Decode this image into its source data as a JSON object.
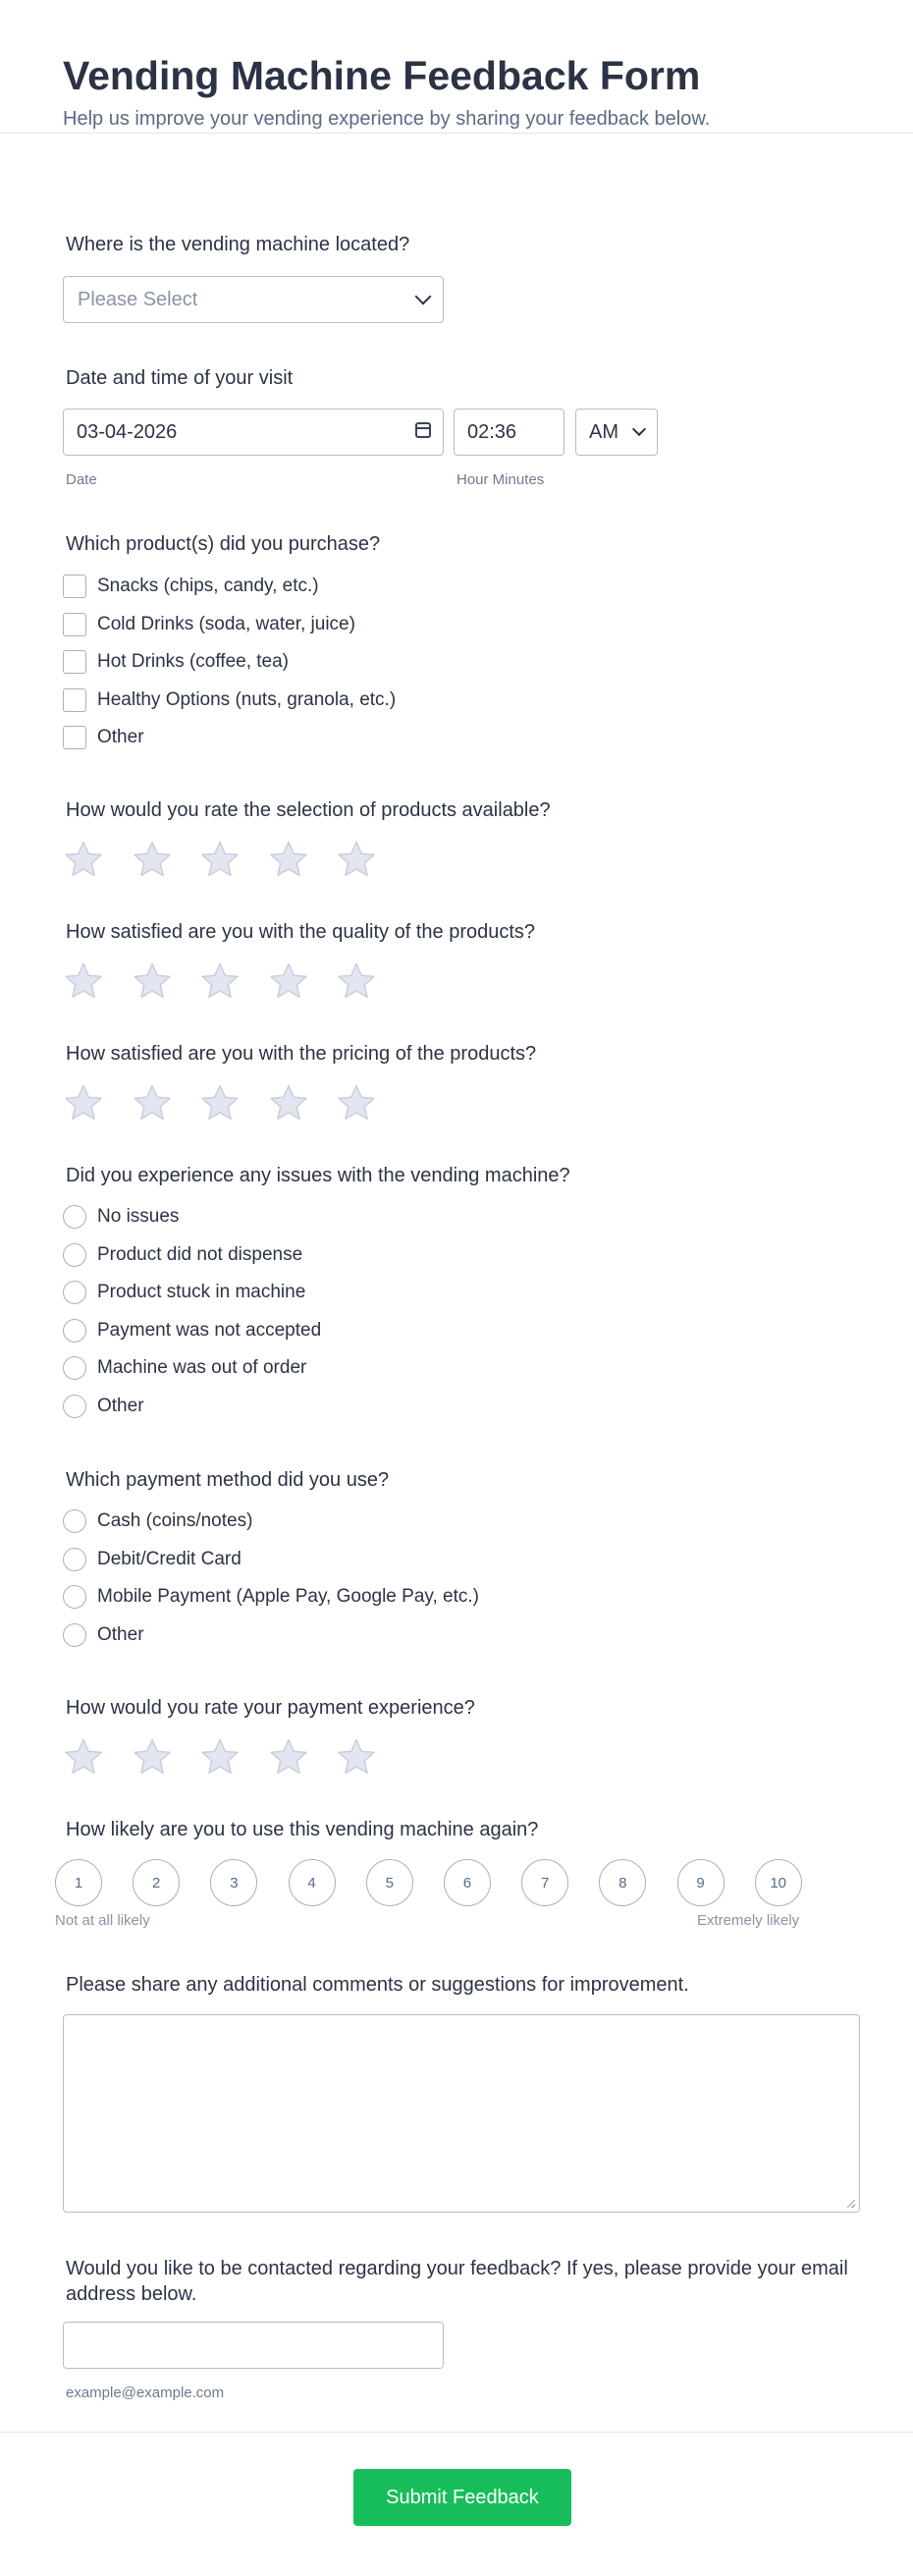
{
  "header": {
    "title": "Vending Machine Feedback Form",
    "subtitle": "Help us improve your vending experience by sharing your feedback below."
  },
  "location": {
    "label": "Where is the vending machine located?",
    "placeholder": "Please Select"
  },
  "visit": {
    "label": "Date and time of your visit",
    "date_value": "03-04-2026",
    "date_sublabel": "Date",
    "time_value": "02:36",
    "time_sublabel": "Hour Minutes",
    "ampm_value": "AM"
  },
  "products": {
    "label": "Which product(s) did you purchase?",
    "options": [
      "Snacks (chips, candy, etc.)",
      "Cold Drinks (soda, water, juice)",
      "Hot Drinks (coffee, tea)",
      "Healthy Options (nuts, granola, etc.)",
      "Other"
    ]
  },
  "rating_selection": {
    "label": "How would you rate the selection of products available?",
    "max": 5,
    "value": 0
  },
  "rating_quality": {
    "label": "How satisfied are you with the quality of the products?",
    "max": 5,
    "value": 0
  },
  "rating_pricing": {
    "label": "How satisfied are you with the pricing of the products?",
    "max": 5,
    "value": 0
  },
  "issues": {
    "label": "Did you experience any issues with the vending machine?",
    "options": [
      "No issues",
      "Product did not dispense",
      "Product stuck in machine",
      "Payment was not accepted",
      "Machine was out of order",
      "Other"
    ]
  },
  "payment": {
    "label": "Which payment method did you use?",
    "options": [
      "Cash (coins/notes)",
      "Debit/Credit Card",
      "Mobile Payment (Apple Pay, Google Pay, etc.)",
      "Other"
    ]
  },
  "rating_payment": {
    "label": "How would you rate your payment experience?",
    "max": 5,
    "value": 0
  },
  "likelihood": {
    "label": "How likely are you to use this vending machine again?",
    "values": [
      "1",
      "2",
      "3",
      "4",
      "5",
      "6",
      "7",
      "8",
      "9",
      "10"
    ],
    "min_label": "Not at all likely",
    "max_label": "Extremely likely"
  },
  "comments": {
    "label": "Please share any additional comments or suggestions for improvement."
  },
  "contact": {
    "label": "Would you like to be contacted regarding your feedback? If yes, please provide your email address below.",
    "sublabel": "example@example.com"
  },
  "submit_label": "Submit Feedback",
  "colors": {
    "star_fill": "#e3e6f0",
    "star_stroke": "#c9cedd",
    "submit_bg": "#18bd5b"
  }
}
